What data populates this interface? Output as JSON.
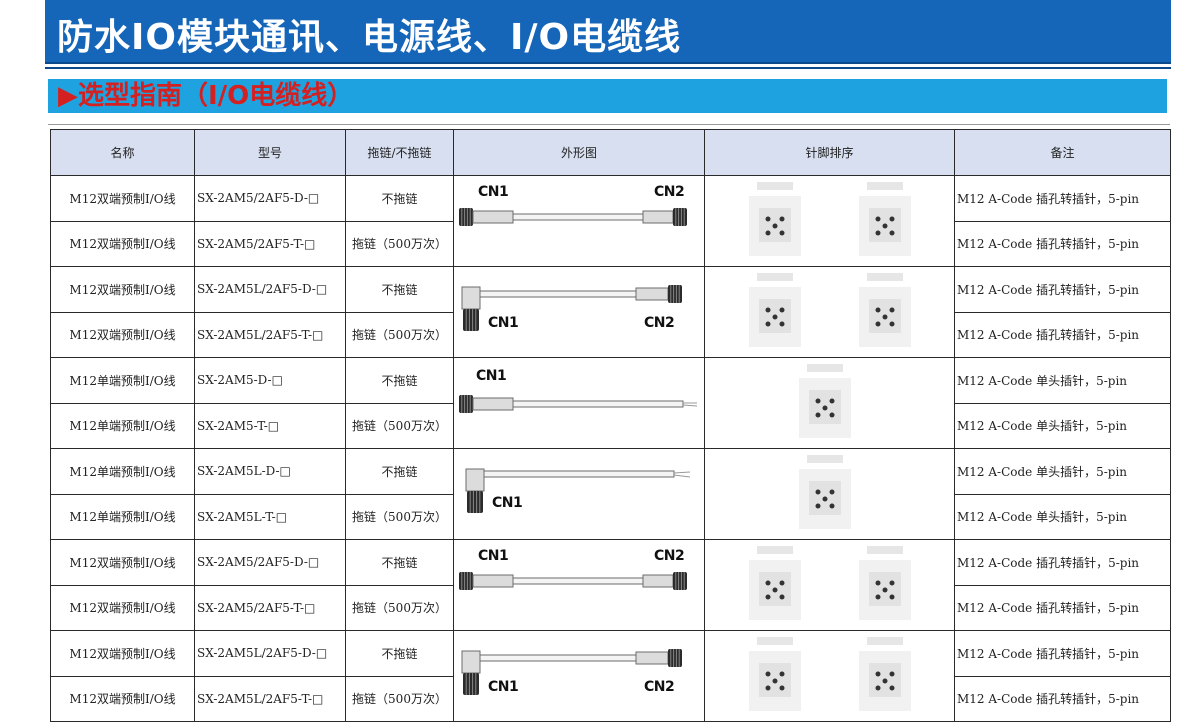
{
  "header": {
    "title": "防水IO模块通讯、电源线、I/O电缆线",
    "section": "▶选型指南（I/O电缆线）"
  },
  "table": {
    "columns": [
      "名称",
      "型号",
      "拖链/不拖链",
      "外形图",
      "针脚排序",
      "备注"
    ],
    "rows": [
      {
        "name": "M12双端预制I/O线",
        "model": "SX-2AM5/2AF5-D-□",
        "drag": "不拖链",
        "note": "M12 A-Code 插孔转插针，5-pin"
      },
      {
        "name": "M12双端预制I/O线",
        "model": "SX-2AM5/2AF5-T-□",
        "drag": "拖链（500万次）",
        "note": "M12 A-Code 插孔转插针，5-pin"
      },
      {
        "name": "M12双端预制I/O线",
        "model": "SX-2AM5L/2AF5-D-□",
        "drag": "不拖链",
        "note": "M12 A-Code 插孔转插针，5-pin"
      },
      {
        "name": "M12双端预制I/O线",
        "model": "SX-2AM5L/2AF5-T-□",
        "drag": "拖链（500万次）",
        "note": "M12 A-Code 插孔转插针，5-pin"
      },
      {
        "name": "M12单端预制I/O线",
        "model": "SX-2AM5-D-□",
        "drag": "不拖链",
        "note": "M12 A-Code 单头插针，5-pin"
      },
      {
        "name": "M12单端预制I/O线",
        "model": "SX-2AM5-T-□",
        "drag": "拖链（500万次）",
        "note": "M12 A-Code 单头插针，5-pin"
      },
      {
        "name": "M12单端预制I/O线",
        "model": "SX-2AM5L-D-□",
        "drag": "不拖链",
        "note": "M12 A-Code 单头插针，5-pin"
      },
      {
        "name": "M12单端预制I/O线",
        "model": "SX-2AM5L-T-□",
        "drag": "拖链（500万次）",
        "note": "M12 A-Code 单头插针，5-pin"
      },
      {
        "name": "M12双端预制I/O线",
        "model": "SX-2AM5/2AF5-D-□",
        "drag": "不拖链",
        "note": "M12 A-Code 插孔转插针，5-pin"
      },
      {
        "name": "M12双端预制I/O线",
        "model": "SX-2AM5/2AF5-T-□",
        "drag": "拖链（500万次）",
        "note": "M12 A-Code 插孔转插针，5-pin"
      },
      {
        "name": "M12双端预制I/O线",
        "model": "SX-2AM5L/2AF5-D-□",
        "drag": "不拖链",
        "note": "M12 A-Code 插孔转插针，5-pin"
      },
      {
        "name": "M12双端预制I/O线",
        "model": "SX-2AM5L/2AF5-T-□",
        "drag": "拖链（500万次）",
        "note": "M12 A-Code 插孔转插针，5-pin"
      }
    ],
    "figures": [
      {
        "type": "straight-double",
        "cn1": "CN1",
        "cn2": "CN2"
      },
      {
        "type": "angled-double",
        "cn1": "CN1",
        "cn2": "CN2"
      },
      {
        "type": "straight-single",
        "cn1": "CN1"
      },
      {
        "type": "angled-single",
        "cn1": "CN1"
      },
      {
        "type": "straight-double",
        "cn1": "CN1",
        "cn2": "CN2"
      },
      {
        "type": "angled-double",
        "cn1": "CN1",
        "cn2": "CN2"
      }
    ]
  }
}
